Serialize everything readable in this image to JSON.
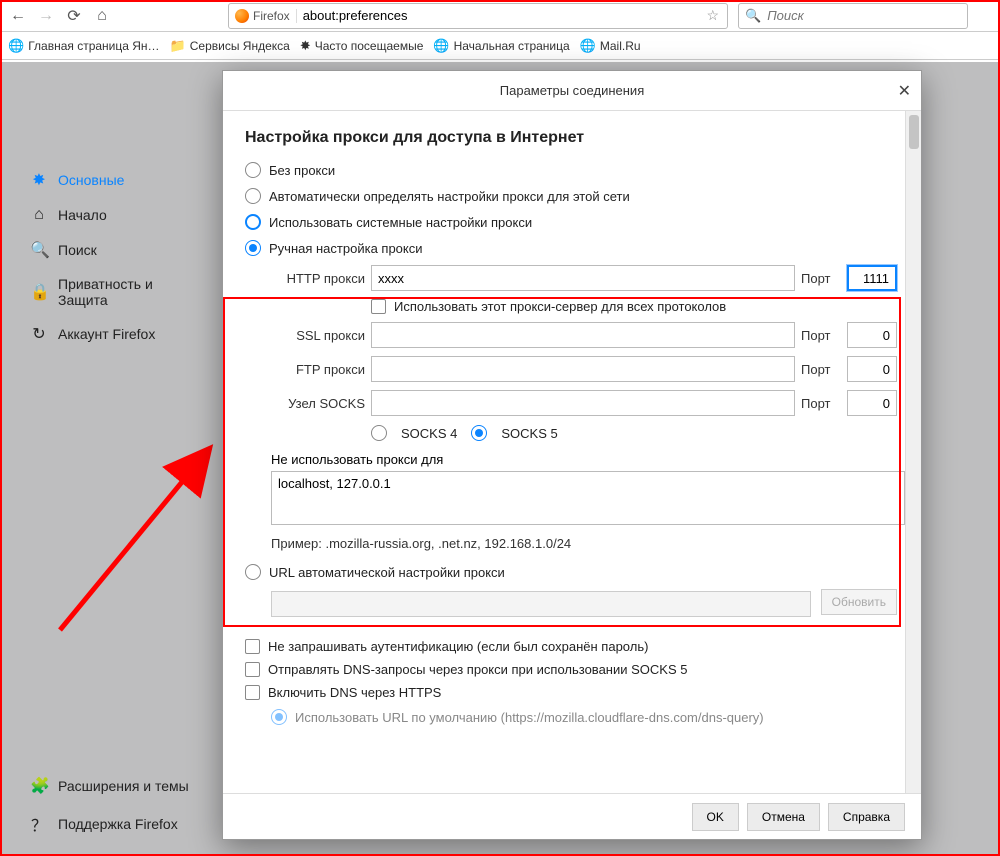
{
  "toolbar": {
    "url": "about:preferences",
    "firefox_label": "Firefox",
    "search_placeholder": "Поиск"
  },
  "bookmarks": [
    {
      "icon": "🌐",
      "label": "Главная страница Ян…"
    },
    {
      "icon": "📁",
      "label": "Сервисы Яндекса"
    },
    {
      "icon": "✸",
      "label": "Часто посещаемые"
    },
    {
      "icon": "🌐",
      "label": "Начальная страница"
    },
    {
      "icon": "🌐",
      "label": "Mail.Ru"
    }
  ],
  "sidebar": {
    "items": [
      {
        "icon": "✸",
        "label": "Основные",
        "active": true
      },
      {
        "icon": "⌂",
        "label": "Начало"
      },
      {
        "icon": "🔍",
        "label": "Поиск"
      },
      {
        "icon": "🔒",
        "label": "Приватность и Защита"
      },
      {
        "icon": "↻",
        "label": "Аккаунт Firefox"
      }
    ],
    "bottom": [
      {
        "icon": "🧩",
        "label": "Расширения и темы"
      },
      {
        "icon": "？",
        "label": "Поддержка Firefox"
      }
    ]
  },
  "dialog": {
    "title": "Параметры соединения",
    "heading": "Настройка прокси для доступа в Интернет",
    "opt_no_proxy": "Без прокси",
    "opt_auto_detect": "Автоматически определять настройки прокси для этой сети",
    "opt_system": "Использовать системные настройки прокси",
    "opt_manual": "Ручная настройка прокси",
    "http_label": "HTTP прокси",
    "http_value": "xxxx",
    "http_port": "1111",
    "port_label": "Порт",
    "use_all": "Использовать этот прокси-сервер для всех протоколов",
    "ssl_label": "SSL прокси",
    "ssl_value": "",
    "ssl_port": "0",
    "ftp_label": "FTP прокси",
    "ftp_value": "",
    "ftp_port": "0",
    "socks_label": "Узел SOCKS",
    "socks_value": "",
    "socks_port": "0",
    "socks4": "SOCKS 4",
    "socks5": "SOCKS 5",
    "noproxy_label": "Не использовать прокси для",
    "noproxy_value": "localhost, 127.0.0.1",
    "example": "Пример: .mozilla-russia.org, .net.nz, 192.168.1.0/24",
    "opt_url_auto": "URL автоматической настройки прокси",
    "refresh": "Обновить",
    "chk_noauth": "Не запрашивать аутентификацию (если был сохранён пароль)",
    "chk_dns_socks": "Отправлять DNS-запросы через прокси при использовании SOCKS 5",
    "chk_dns_https": "Включить DNS через HTTPS",
    "opt_default_url": "Использовать URL по умолчанию (https://mozilla.cloudflare-dns.com/dns-query)",
    "ok": "OK",
    "cancel": "Отмена",
    "help": "Справка"
  }
}
